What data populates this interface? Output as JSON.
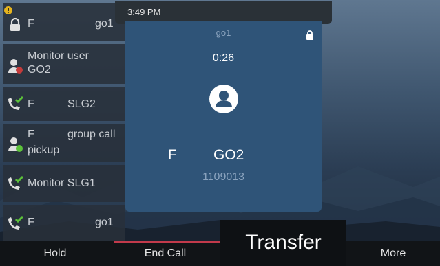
{
  "status_bar": {
    "time": "3:49 PM"
  },
  "line_keys": [
    {
      "label": "F",
      "right_label": "go1",
      "icon": "lock-icon",
      "badge": "warning-badge-icon"
    },
    {
      "label": "Monitor user",
      "sub_label": "GO2",
      "icon": "person-busy-icon"
    },
    {
      "label": "F",
      "right_label": "SLG2",
      "icon": "call-check-icon"
    },
    {
      "label": "F",
      "right_label": "group call",
      "sub_label": "pickup",
      "icon": "person-available-icon"
    },
    {
      "label": "Monitor SLG1",
      "icon": "call-check-icon"
    },
    {
      "label": "F",
      "right_label": "go1",
      "icon": "call-check-icon"
    }
  ],
  "call": {
    "line_name": "go1",
    "duration": "0:26",
    "caller_label": "F",
    "caller_name": "GO2",
    "caller_number": "1109013"
  },
  "softkeys": {
    "hold": "Hold",
    "end_call": "End Call",
    "transfer": "Transfer",
    "more": "More"
  },
  "colors": {
    "panel": "#2f5478",
    "key_bg": "#28303a",
    "end_call_accent": "#c23a4b",
    "presence_green": "#5cc23a",
    "presence_red": "#c43b3b",
    "warning_yellow": "#e6b41e"
  }
}
